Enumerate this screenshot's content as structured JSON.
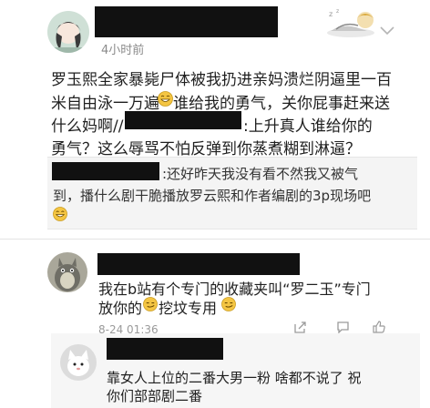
{
  "post": {
    "time": "4小时前",
    "body_lines": [
      "罗玉熙全家暴毙尸体被我扔进亲妈溃烂阴逼里一百",
      "米自由泳一万遍",
      "谁给我的勇气，关你屁事赶来送",
      "什么妈啊//",
      ":上升真人谁给你的",
      "勇气？这么辱骂不怕反弹到你蒸煮糊到淋逼？"
    ]
  },
  "quote": {
    "line1": ":还好昨天我没有看不然我又被气",
    "line2": "到，播什么剧干脆播放罗云熙和作者编剧的3p现场吧"
  },
  "comment1": {
    "line1": "我在b站有个专门的收藏夹叫“罗二玉”专门",
    "line2a": "放你的",
    "line2b": "挖坟专用",
    "time": "8-24 01:36"
  },
  "reply": {
    "line1": "靠女人上位的二番大男一粉  啥都不说了 祝",
    "line2": "你们部部剧二番"
  },
  "colors": {
    "redaction": "#111111",
    "divider": "#e3e3e3",
    "quote_bg": "#f4f4f4",
    "emoji": "#f4c542"
  },
  "icons": [
    "avatar-anime-girl",
    "sleeping-girl-badge",
    "chevron-down-icon",
    "emoji-grin-icon",
    "avatar-totoro",
    "emoji-smirk-icon",
    "share-icon",
    "comment-icon",
    "like-icon",
    "avatar-cat"
  ]
}
